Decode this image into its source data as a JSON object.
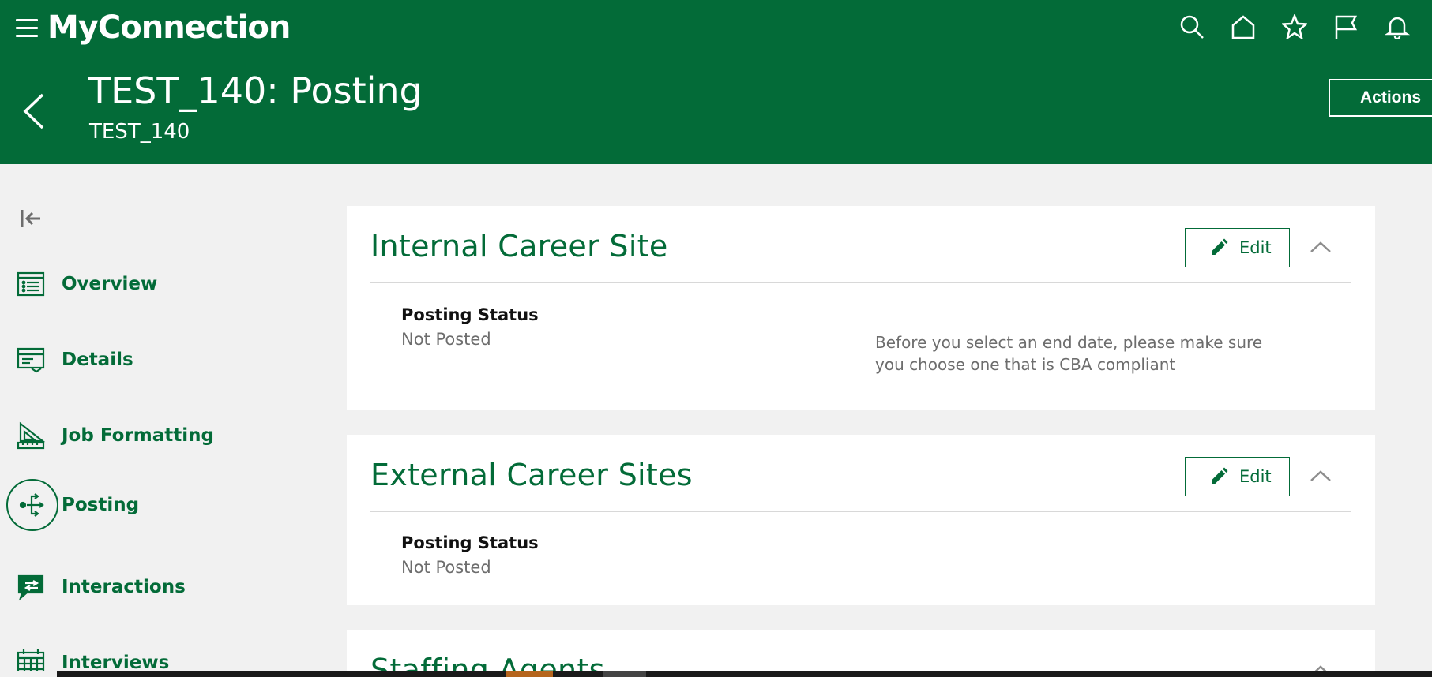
{
  "app": {
    "brand": "MyConnection"
  },
  "header": {
    "title": "TEST_140: Posting",
    "subtitle": "TEST_140",
    "actions_label": "Actions",
    "icons": [
      "search-icon",
      "home-icon",
      "star-icon",
      "flag-icon",
      "bell-icon"
    ]
  },
  "sidebar": {
    "items": [
      {
        "label": "Overview",
        "icon": "list-icon"
      },
      {
        "label": "Details",
        "icon": "details-icon"
      },
      {
        "label": "Job Formatting",
        "icon": "ruler-icon"
      },
      {
        "label": "Posting",
        "icon": "posting-icon",
        "active": true
      },
      {
        "label": "Interactions",
        "icon": "chat-icon"
      },
      {
        "label": "Interviews",
        "icon": "calendar-icon"
      }
    ]
  },
  "sections": [
    {
      "title": "Internal Career Site",
      "edit_label": "Edit",
      "field_label": "Posting Status",
      "field_value": "Not Posted",
      "note": "Before you select an end date, please make sure you choose one that is CBA compliant"
    },
    {
      "title": "External Career Sites",
      "edit_label": "Edit",
      "field_label": "Posting Status",
      "field_value": "Not Posted"
    },
    {
      "title": "Staffing Agents"
    }
  ],
  "colors": {
    "brand_green": "#036b38",
    "background": "#f1f1f1",
    "muted_text": "#6d6d6d"
  }
}
